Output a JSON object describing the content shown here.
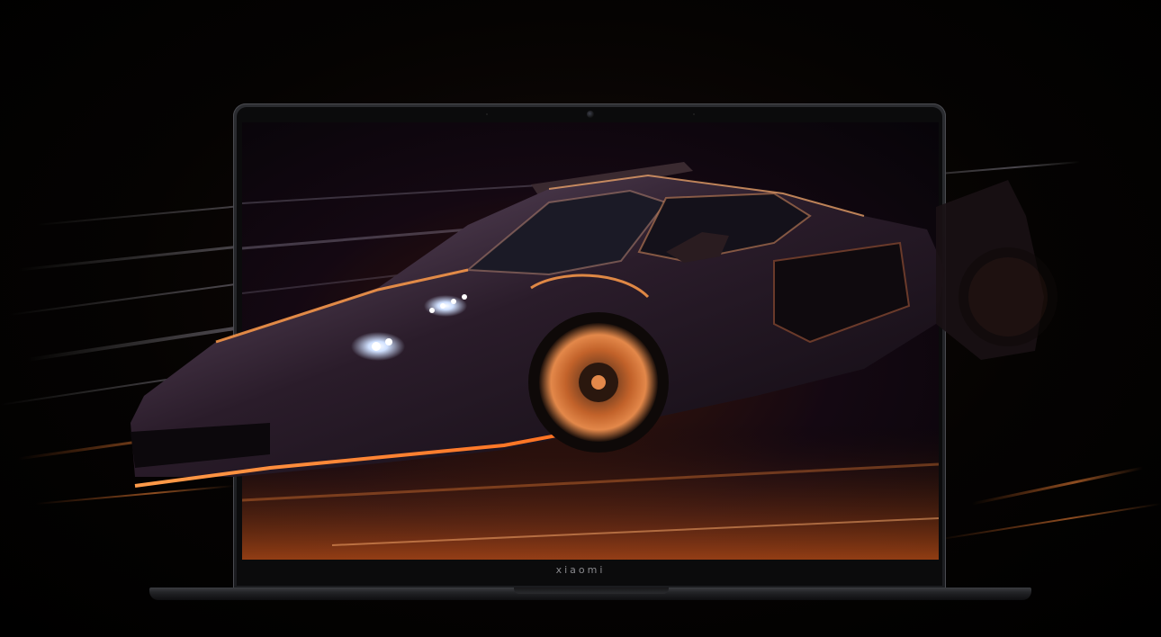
{
  "brand": {
    "logo_text": "xiaomi"
  },
  "scene": {
    "subject_icon": "sports-car-illustration",
    "accent_color": "#ff8a3a",
    "light_color": "#cfe0ff"
  }
}
